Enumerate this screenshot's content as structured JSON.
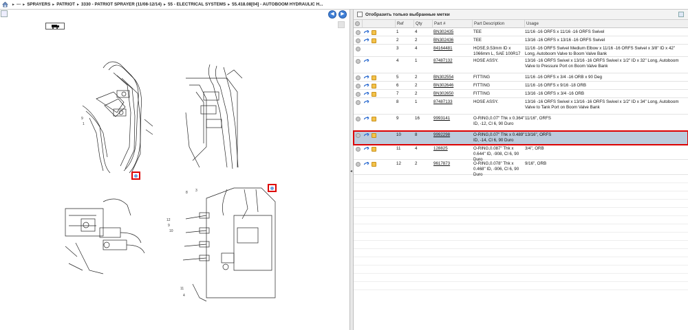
{
  "breadcrumb": {
    "items": [
      "---",
      "SPRAYERS",
      "PATRIOT",
      "3330 - PATRIOT SPRAYER (11/08-12/14)",
      "55 - ELECTRICAL SYSTEMS",
      "55.418.08[04] - AUTOBOOM HYDRAULIC H..."
    ]
  },
  "icons": {
    "home": "home-icon",
    "print": "print-icon",
    "back": "back-arrow-icon",
    "forward": "forward-arrow-icon",
    "truck": "truck-icon",
    "info": "info-icon",
    "arrow": "arrow-icon",
    "box": "package-icon"
  },
  "filter": {
    "label": "Отобразить только выбранные метки"
  },
  "table": {
    "headers": [
      "Ref",
      "Qty",
      "Part #",
      "Part Description",
      "Usage"
    ],
    "rows": [
      {
        "ref": "1",
        "qty": "4",
        "part": "BN302435",
        "desc": "TEE",
        "usage": "11/16 -16 ORFS x 11/16 -16 ORFS Swivel",
        "icons": [
          "info",
          "arrow",
          "box"
        ]
      },
      {
        "ref": "2",
        "qty": "2",
        "part": "BN302436",
        "desc": "TEE",
        "usage": "13/16 -16 ORFS x 13/16 -16 ORFS Swivel",
        "icons": [
          "info",
          "arrow",
          "box"
        ]
      },
      {
        "ref": "3",
        "qty": "4",
        "part": "84164481",
        "desc": "HOSE,9.53mm ID x 1066mm L, SAE 100R17",
        "usage": "11/16 -16 ORFS Swivel Medium Elbow x 11/16 -16 ORFS Swivel x 3/8\" ID x 42\" Long, Autoboom Valve to Boom Valve Bank",
        "icons": [
          "info"
        ]
      },
      {
        "ref": "4",
        "qty": "1",
        "part": "87487132",
        "desc": "HOSE ASSY.",
        "usage": "13/16 -16 ORFS Swivel x 13/16 -16 ORFS Swivel x 1/2\" ID x 32\" Long, Autoboom Valve to Pressure Port on Boom Valve Bank",
        "icons": [
          "info",
          "arrow"
        ]
      },
      {
        "ref": "5",
        "qty": "2",
        "part": "BN302554",
        "desc": "FITTING",
        "usage": "11/16 -16 ORFS x 3/4 -16 ORB x 90 Deg",
        "icons": [
          "info",
          "arrow",
          "box"
        ]
      },
      {
        "ref": "6",
        "qty": "2",
        "part": "BN302646",
        "desc": "FITTING",
        "usage": "11/16 -16 ORFS x 9/16 -18 ORB",
        "icons": [
          "info",
          "arrow",
          "box"
        ]
      },
      {
        "ref": "7",
        "qty": "2",
        "part": "BN302650",
        "desc": "FITTING",
        "usage": "13/16 -16 ORFS x 3/4 -16 ORB",
        "icons": [
          "info",
          "arrow",
          "box"
        ]
      },
      {
        "ref": "8",
        "qty": "1",
        "part": "87487133",
        "desc": "HOSE ASSY.",
        "usage": "13/16 -16 ORFS Swivel x 13/16 -16 ORFS Swivel x 1/2\" ID x 34\" Long, Autoboom Valve to Tank Port on Boom Valve Bank",
        "icons": [
          "info",
          "arrow"
        ]
      },
      {
        "ref": "9",
        "qty": "16",
        "part": "9993141",
        "desc": "O-RING,0.07\" Thk x 0.364\" ID, -12, Cl 6, 90 Duro",
        "usage": "11/16\", ORFS",
        "icons": [
          "info",
          "arrow",
          "box"
        ]
      },
      {
        "ref": "10",
        "qty": "8",
        "part": "9992298",
        "desc": "O-RING,0.07\" Thk x 0.489\" ID, -14, Cl 6, 90 Duro",
        "usage": "13/16\", ORFS",
        "icons": [
          "info",
          "arrow",
          "box"
        ],
        "selected": true
      },
      {
        "ref": "11",
        "qty": "4",
        "part": "128825",
        "desc": "O-RING,0.087\" Thk x 0.644\" ID, -908, Cl 6, 90 Duro",
        "usage": "3/4\", ORB",
        "icons": [
          "info",
          "arrow",
          "box"
        ]
      },
      {
        "ref": "12",
        "qty": "2",
        "part": "9617873",
        "desc": "O-RING,0.078\" Thk x 0.468\" ID, -906, Cl 6, 90 Duro",
        "usage": "9/16\", ORB",
        "icons": [
          "info",
          "arrow",
          "box"
        ]
      }
    ]
  }
}
